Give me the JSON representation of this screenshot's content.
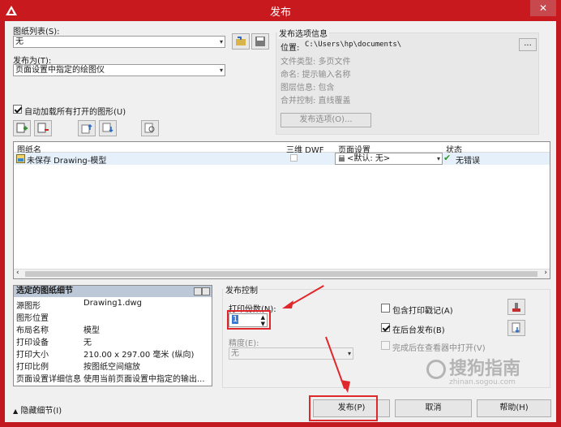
{
  "window": {
    "title": "发布",
    "close": "✕"
  },
  "sheet_list": {
    "label": "图纸列表(S):",
    "value": "无",
    "arrow": "▾"
  },
  "publish_to": {
    "label": "发布为(T):",
    "value": "页面设置中指定的绘图仪",
    "arrow": "▾"
  },
  "publish_options_info": {
    "title": "发布选项信息",
    "location_label": "位置:",
    "location_value": "C:\\Users\\hp\\documents\\",
    "browse": "...",
    "file_type": "文件类型: 多页文件",
    "naming": "命名: 提示输入名称",
    "layer_info": "图层信息: 包含",
    "merge_control": "合并控制: 直线覆盖",
    "options_button": "发布选项(O)..."
  },
  "auto_load": {
    "label": "自动加载所有打开的图形(U)",
    "checked": true
  },
  "table": {
    "headers": [
      "图纸名",
      "三维 DWF",
      "页面设置",
      "状态"
    ],
    "rows": [
      {
        "name": "未保存 Drawing-模型",
        "page_setup": "<默认: 无>",
        "status": "无错误"
      }
    ]
  },
  "details": {
    "title": "选定的图纸细节",
    "fields": [
      {
        "key": "源图形",
        "value": "Drawing1.dwg"
      },
      {
        "key": "图形位置",
        "value": ""
      },
      {
        "key": "布局名称",
        "value": "模型"
      },
      {
        "key": "打印设备",
        "value": "无"
      },
      {
        "key": "打印大小",
        "value": "210.00 x 297.00 毫米 (纵向)"
      },
      {
        "key": "打印比例",
        "value": "按图纸空间缩放"
      },
      {
        "key": "页面设置详细信息",
        "value": "使用当前页面设置中指定的输出..."
      }
    ]
  },
  "publish_control": {
    "title": "发布控制",
    "copies_label": "打印份数(N):",
    "copies_value": "1",
    "precision_label": "精度(E):",
    "precision_value": "无",
    "include_stamp": {
      "label": "包含打印戳记(A)",
      "checked": false
    },
    "background": {
      "label": "在后台发布(B)",
      "checked": true
    },
    "open_viewer": {
      "label": "完成后在查看器中打开(V)",
      "checked": false
    }
  },
  "footer": {
    "hide_details": "隐藏细节(I)",
    "publish": "发布(P)",
    "cancel": "取消",
    "help": "帮助(H)"
  },
  "watermark": {
    "text": "搜狗指南",
    "sub": "zhinan.sogou.com"
  },
  "colors": {
    "title_bar": "#c8191f",
    "annotation_red": "#e0282c",
    "ok_green": "#2a9a2a"
  }
}
